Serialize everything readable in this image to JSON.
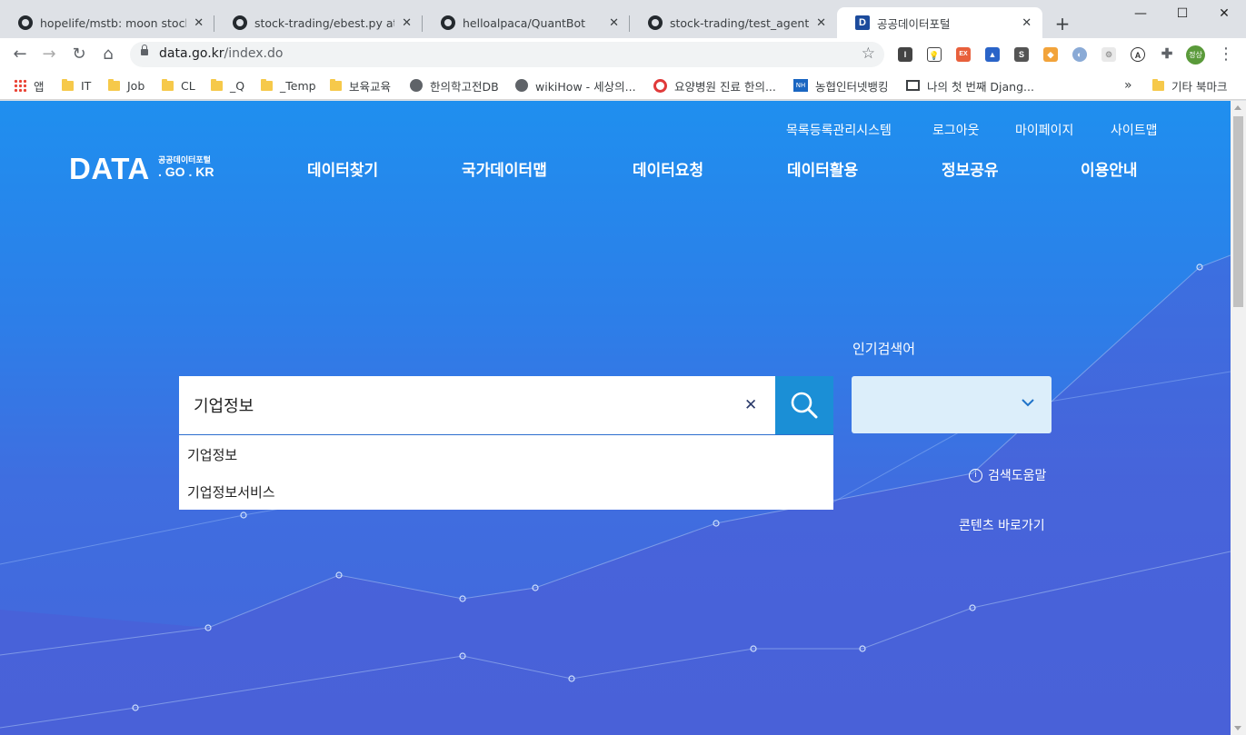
{
  "browser": {
    "tabs": [
      {
        "title": "hopelife/mstb: moon stock tra",
        "icon": "github-icon"
      },
      {
        "title": "stock-trading/ebest.py at mas",
        "icon": "github-icon"
      },
      {
        "title": "helloalpaca/QuantBot",
        "icon": "github-icon"
      },
      {
        "title": "stock-trading/test_agent_ebes",
        "icon": "github-icon"
      },
      {
        "title": "공공데이터포털",
        "icon": "data-portal-icon",
        "active": true
      }
    ],
    "url_host": "data.go.kr",
    "url_path": "/index.do",
    "profile_label": "정상",
    "bookmarks": [
      {
        "label": "앱",
        "icon": "apps-icon"
      },
      {
        "label": "IT",
        "icon": "folder-icon"
      },
      {
        "label": "Job",
        "icon": "folder-icon"
      },
      {
        "label": "CL",
        "icon": "folder-icon"
      },
      {
        "label": "_Q",
        "icon": "folder-icon"
      },
      {
        "label": "_Temp",
        "icon": "folder-icon"
      },
      {
        "label": "보육교육",
        "icon": "folder-icon"
      },
      {
        "label": "한의학고전DB",
        "icon": "globe-icon"
      },
      {
        "label": "wikiHow - 세상의...",
        "icon": "globe-icon"
      },
      {
        "label": "요양병원 진료 한의...",
        "icon": "ring-icon"
      },
      {
        "label": "농협인터넷뱅킹",
        "icon": "nh-icon"
      },
      {
        "label": "나의 첫 번째 Djang...",
        "icon": "book-icon"
      }
    ],
    "other_bookmarks": "기타 북마크",
    "overflow": "»"
  },
  "site": {
    "util_links": [
      "목록등록관리시스템",
      "로그아웃",
      "마이페이지",
      "사이트맵"
    ],
    "logo": {
      "main": "DATA",
      "sub_top": "공공데이터포털",
      "sub_bottom": ". GO . KR"
    },
    "nav": [
      "데이터찾기",
      "국가데이터맵",
      "데이터요청",
      "데이터활용",
      "정보공유",
      "이용안내"
    ],
    "search": {
      "value": "기업정보",
      "suggestions": [
        "기업정보",
        "기업정보서비스"
      ]
    },
    "popular_label": "인기검색어",
    "popular_selected": "",
    "help_label": "검색도움말",
    "shortcut_label": "콘텐츠 바로가기"
  },
  "colors": {
    "bg_top": "#1f8fef",
    "bg_bottom": "#4466da",
    "search_button": "#1b8fd6",
    "select_bg": "#dceefa"
  }
}
